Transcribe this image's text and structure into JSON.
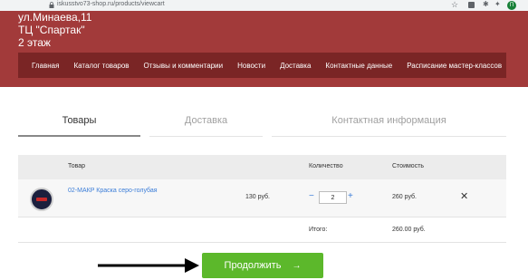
{
  "browser": {
    "url": "iskusstvo73-shop.ru/products/viewcart",
    "profile_initial": "П"
  },
  "header": {
    "address_line1": "ул.Минаева,11",
    "address_line2": "ТЦ \"Спартак\"",
    "address_line3": "2 этаж",
    "bg_color": "#a23a3a",
    "nav_color": "#7a2525"
  },
  "nav": {
    "items": [
      "Главная",
      "Каталог товаров",
      "Отзывы и комментарии",
      "Новости",
      "Доставка",
      "Контактные данные",
      "Расписание мастер-классов"
    ]
  },
  "tabs": {
    "goods": "Товары",
    "delivery": "Доставка",
    "contact": "Контактная информация"
  },
  "cart": {
    "columns": {
      "product": "Товар",
      "quantity": "Количество",
      "cost": "Стоимость"
    },
    "items": [
      {
        "name": "02-МАКР Краска серо-голубая",
        "unit_price": "130 руб.",
        "quantity": "2",
        "total": "260 руб.",
        "minus": "−",
        "plus": "+",
        "remove": "✕"
      }
    ],
    "total_label": "Итого:",
    "total_value": "260.00 руб."
  },
  "continue_button": {
    "label": "Продолжить",
    "icon": "→",
    "color": "#5cb82b"
  },
  "link_color": "#3b7dd8"
}
